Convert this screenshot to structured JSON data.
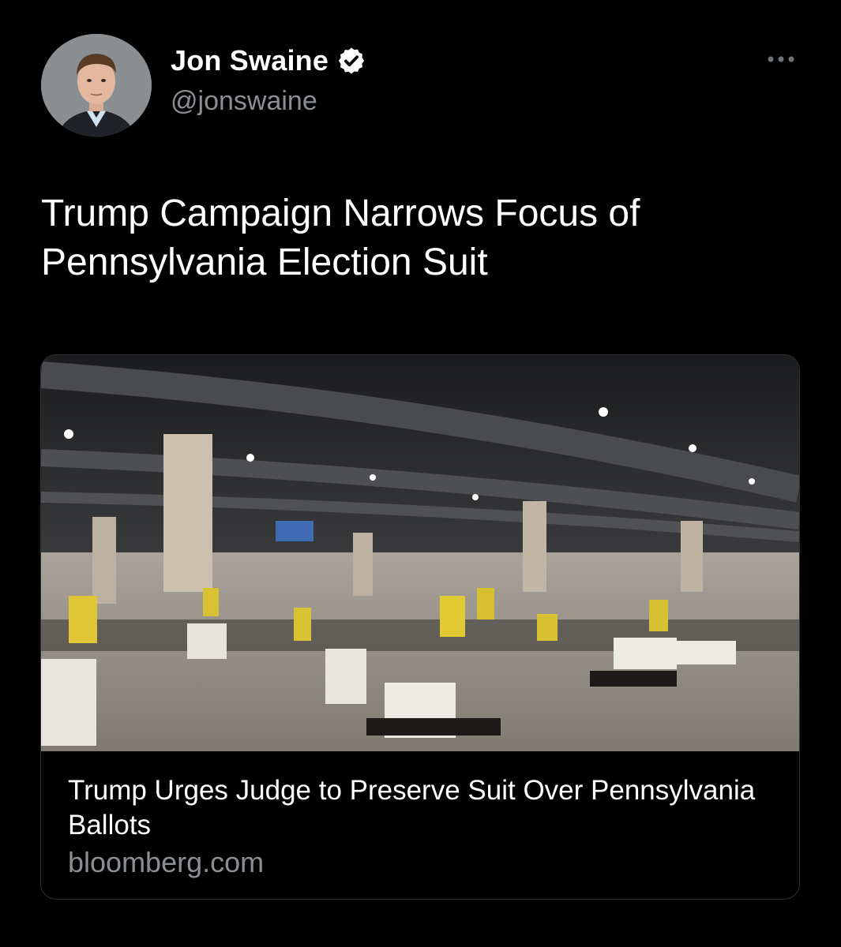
{
  "tweet": {
    "author": {
      "display_name": "Jon Swaine",
      "handle": "@jonswaine",
      "verified": true
    },
    "text": "Trump Campaign Narrows Focus of Pennsylvania Election Suit",
    "more_icon": "more-horizontal-icon",
    "verified_icon": "verified-badge-icon",
    "link_card": {
      "title": "Trump Urges Judge to Preserve Suit Over Pennsylvania Ballots",
      "domain": "bloomberg.com"
    },
    "colors": {
      "background": "#000000",
      "text": "#ffffff",
      "secondary_text": "#8b8f94",
      "card_border": "#2f3336"
    }
  }
}
